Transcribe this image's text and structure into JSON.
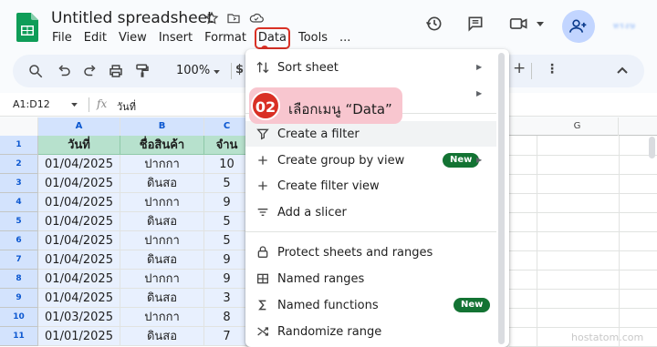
{
  "doc_title": "Untitled spreadsheet",
  "menu": [
    "File",
    "Edit",
    "View",
    "Insert",
    "Format",
    "Data",
    "Tools",
    "..."
  ],
  "active_menu_index": 5,
  "account_label": "ทรงษ",
  "zoom": "100%",
  "currency_symbol": "$",
  "name_box": "A1:D12",
  "fx_label": "fx",
  "formula_value": "วันที่",
  "columns": [
    "A",
    "B",
    "C",
    "G"
  ],
  "rows": [
    "1",
    "2",
    "3",
    "4",
    "5",
    "6",
    "7",
    "8",
    "9",
    "10",
    "11"
  ],
  "table": {
    "headers": [
      "วันที่",
      "ชื่อสินค้า",
      "จำน"
    ],
    "body": [
      [
        "01/04/2025",
        "ปากกา",
        "10"
      ],
      [
        "01/04/2025",
        "ดินสอ",
        "5"
      ],
      [
        "01/04/2025",
        "ปากกา",
        "9"
      ],
      [
        "01/04/2025",
        "ดินสอ",
        "5"
      ],
      [
        "01/04/2025",
        "ปากกา",
        "5"
      ],
      [
        "01/04/2025",
        "ดินสอ",
        "9"
      ],
      [
        "01/04/2025",
        "ปากกา",
        "9"
      ],
      [
        "01/04/2025",
        "ดินสอ",
        "3"
      ],
      [
        "01/03/2025",
        "ปากกา",
        "8"
      ],
      [
        "01/01/2025",
        "ดินสอ",
        "7"
      ]
    ]
  },
  "dropdown": {
    "items": [
      {
        "label": "Sort sheet",
        "icon": "sort-icon",
        "submenu": true
      },
      {
        "label": "",
        "icon": "",
        "submenu": true
      },
      {
        "label": "Create a filter",
        "icon": "filter-icon",
        "submenu": false,
        "highlight": true
      },
      {
        "label": "Create group by view",
        "icon": "plus-icon",
        "submenu": true,
        "badge": "New"
      },
      {
        "label": "Create filter view",
        "icon": "plus-icon",
        "submenu": false
      },
      {
        "label": "Add a slicer",
        "icon": "slicer-icon",
        "submenu": false
      },
      {
        "label": "Protect sheets and ranges",
        "icon": "lock-icon",
        "submenu": false
      },
      {
        "label": "Named ranges",
        "icon": "named-ranges-icon",
        "submenu": false
      },
      {
        "label": "Named functions",
        "icon": "sigma-icon",
        "submenu": false,
        "badge": "New"
      },
      {
        "label": "Randomize range",
        "icon": "shuffle-icon",
        "submenu": false
      }
    ]
  },
  "callout": {
    "step": "02",
    "text": "เลือกเมนู “Data”"
  },
  "watermark": "hostatom.com",
  "colors": {
    "accent": "#0b57d0",
    "header_fill": "#b7e1cd",
    "badge_green": "#137333",
    "callout_red": "#d93025",
    "callout_pink": "#f8c6cf"
  }
}
